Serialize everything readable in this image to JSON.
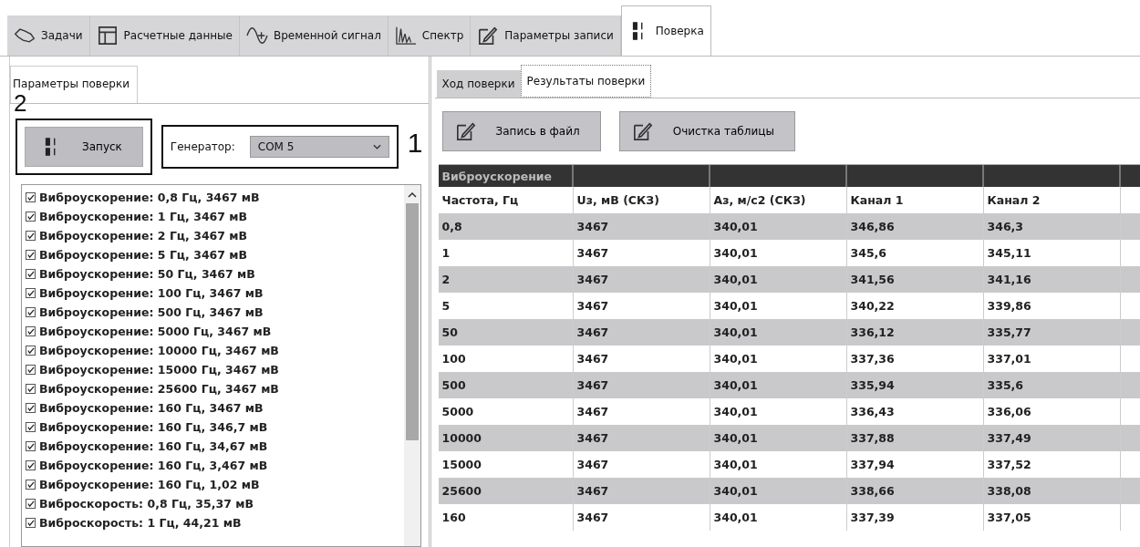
{
  "main_tabs": [
    {
      "label": "Задачи",
      "selected": false
    },
    {
      "label": "Расчетные данные",
      "selected": false
    },
    {
      "label": "Временной сигнал",
      "selected": false
    },
    {
      "label": "Спектр",
      "selected": false
    },
    {
      "label": "Параметры записи",
      "selected": false
    },
    {
      "label": "Поверка",
      "selected": true
    }
  ],
  "left_panel": {
    "tabs": [
      {
        "label": "Параметры поверки",
        "selected": true
      }
    ],
    "start_button": {
      "label": "Запуск"
    },
    "generator": {
      "label": "Генератор:",
      "value": "COM 5"
    },
    "annotations": [
      "2",
      "1"
    ],
    "list": [
      {
        "label": "Виброускорение: 0,8 Гц, 3467 мВ",
        "checked": true
      },
      {
        "label": "Виброускорение: 1 Гц, 3467 мВ",
        "checked": true
      },
      {
        "label": "Виброускорение: 2 Гц, 3467 мВ",
        "checked": true
      },
      {
        "label": "Виброускорение: 5 Гц, 3467 мВ",
        "checked": true
      },
      {
        "label": "Виброускорение: 50 Гц, 3467 мВ",
        "checked": true
      },
      {
        "label": "Виброускорение: 100 Гц, 3467 мВ",
        "checked": true
      },
      {
        "label": "Виброускорение: 500 Гц, 3467 мВ",
        "checked": true
      },
      {
        "label": "Виброускорение: 5000 Гц, 3467 мВ",
        "checked": true
      },
      {
        "label": "Виброускорение: 10000 Гц, 3467 мВ",
        "checked": true
      },
      {
        "label": "Виброускорение: 15000 Гц, 3467 мВ",
        "checked": true
      },
      {
        "label": "Виброускорение: 25600 Гц, 3467 мВ",
        "checked": true
      },
      {
        "label": "Виброускорение: 160 Гц, 3467 мВ",
        "checked": true
      },
      {
        "label": "Виброускорение: 160 Гц, 346,7 мВ",
        "checked": true
      },
      {
        "label": "Виброускорение: 160 Гц, 34,67 мВ",
        "checked": true
      },
      {
        "label": "Виброускорение: 160 Гц, 3,467 мВ",
        "checked": true
      },
      {
        "label": "Виброускорение: 160 Гц, 1,02 мВ",
        "checked": true
      },
      {
        "label": "Виброскорость: 0,8 Гц, 35,37 мВ",
        "checked": true
      },
      {
        "label": "Виброскорость: 1 Гц, 44,21 мВ",
        "checked": true
      }
    ]
  },
  "right_panel": {
    "tabs": [
      {
        "label": "Ход поверки",
        "selected": false
      },
      {
        "label": "Результаты поверки",
        "selected": true
      }
    ],
    "buttons": [
      "Запись в файл",
      "Очистка таблицы"
    ],
    "table": {
      "group": "Виброускорение",
      "columns": [
        "Частота, Гц",
        "Uз, мВ (СКЗ)",
        "Аз, м/с2 (СКЗ)",
        "Канал 1",
        "Канал 2"
      ],
      "rows": [
        [
          "0,8",
          "3467",
          "340,01",
          "346,86",
          "346,3"
        ],
        [
          "1",
          "3467",
          "340,01",
          "345,6",
          "345,11"
        ],
        [
          "2",
          "3467",
          "340,01",
          "341,56",
          "341,16"
        ],
        [
          "5",
          "3467",
          "340,01",
          "340,22",
          "339,86"
        ],
        [
          "50",
          "3467",
          "340,01",
          "336,12",
          "335,77"
        ],
        [
          "100",
          "3467",
          "340,01",
          "337,36",
          "337,01"
        ],
        [
          "500",
          "3467",
          "340,01",
          "335,94",
          "335,6"
        ],
        [
          "5000",
          "3467",
          "340,01",
          "336,43",
          "336,06"
        ],
        [
          "10000",
          "3467",
          "340,01",
          "337,88",
          "337,49"
        ],
        [
          "15000",
          "3467",
          "340,01",
          "337,94",
          "337,52"
        ],
        [
          "25600",
          "3467",
          "340,01",
          "338,66",
          "338,08"
        ],
        [
          "160",
          "3467",
          "340,01",
          "337,39",
          "337,05"
        ]
      ]
    }
  }
}
